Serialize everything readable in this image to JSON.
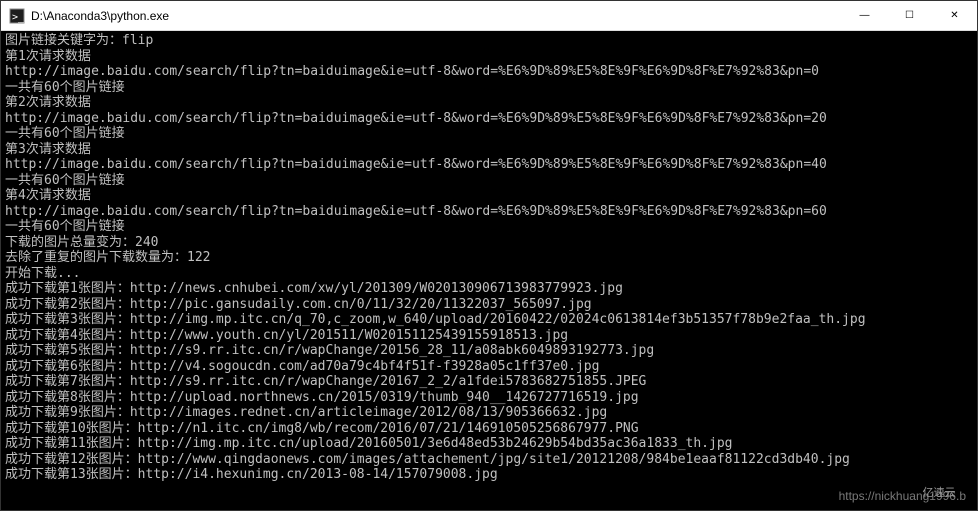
{
  "titlebar": {
    "title": "D:\\Anaconda3\\python.exe",
    "minimize": "—",
    "maximize": "☐",
    "close": "✕"
  },
  "terminal": {
    "lines": [
      "图片链接关键字为：flip",
      "第1次请求数据",
      "http://image.baidu.com/search/flip?tn=baiduimage&ie=utf-8&word=%E6%9D%89%E5%8E%9F%E6%9D%8F%E7%92%83&pn=0",
      "一共有60个图片链接",
      "第2次请求数据",
      "http://image.baidu.com/search/flip?tn=baiduimage&ie=utf-8&word=%E6%9D%89%E5%8E%9F%E6%9D%8F%E7%92%83&pn=20",
      "一共有60个图片链接",
      "第3次请求数据",
      "http://image.baidu.com/search/flip?tn=baiduimage&ie=utf-8&word=%E6%9D%89%E5%8E%9F%E6%9D%8F%E7%92%83&pn=40",
      "一共有60个图片链接",
      "第4次请求数据",
      "http://image.baidu.com/search/flip?tn=baiduimage&ie=utf-8&word=%E6%9D%89%E5%8E%9F%E6%9D%8F%E7%92%83&pn=60",
      "一共有60个图片链接",
      "下载的图片总量变为：240",
      "去除了重复的图片下载数量为：122",
      "",
      "开始下载...",
      "成功下载第1张图片：http://news.cnhubei.com/xw/yl/201309/W020130906713983779923.jpg",
      "成功下载第2张图片：http://pic.gansudaily.com.cn/0/11/32/20/11322037_565097.jpg",
      "成功下载第3张图片：http://img.mp.itc.cn/q_70,c_zoom,w_640/upload/20160422/02024c0613814ef3b51357f78b9e2faa_th.jpg",
      "成功下载第4张图片：http://www.youth.cn/yl/201511/W020151125439155918513.jpg",
      "成功下载第5张图片：http://s9.rr.itc.cn/r/wapChange/20156_28_11/a08abk6049893192773.jpg",
      "成功下载第6张图片：http://v4.sogoucdn.com/ad70a79c4bf4f51f-f3928a05c1ff37e0.jpg",
      "成功下载第7张图片：http://s9.rr.itc.cn/r/wapChange/20167_2_2/a1fdei5783682751855.JPEG",
      "成功下载第8张图片：http://upload.northnews.cn/2015/0319/thumb_940__1426727716519.jpg",
      "成功下载第9张图片：http://images.rednet.cn/articleimage/2012/08/13/905366632.jpg",
      "成功下载第10张图片：http://n1.itc.cn/img8/wb/recom/2016/07/21/146910505256867977.PNG",
      "成功下载第11张图片：http://img.mp.itc.cn/upload/20160501/3e6d48ed53b24629b54bd35ac36a1833_th.jpg",
      "成功下载第12张图片：http://www.qingdaonews.com/images/attachement/jpg/site1/20121208/984be1eaaf81122cd3db40.jpg",
      "成功下载第13张图片：http://i4.hexunimg.cn/2013-08-14/157079008.jpg"
    ]
  },
  "watermark": {
    "text": "https://nickhuang1996.b",
    "brand": "亿速云"
  }
}
